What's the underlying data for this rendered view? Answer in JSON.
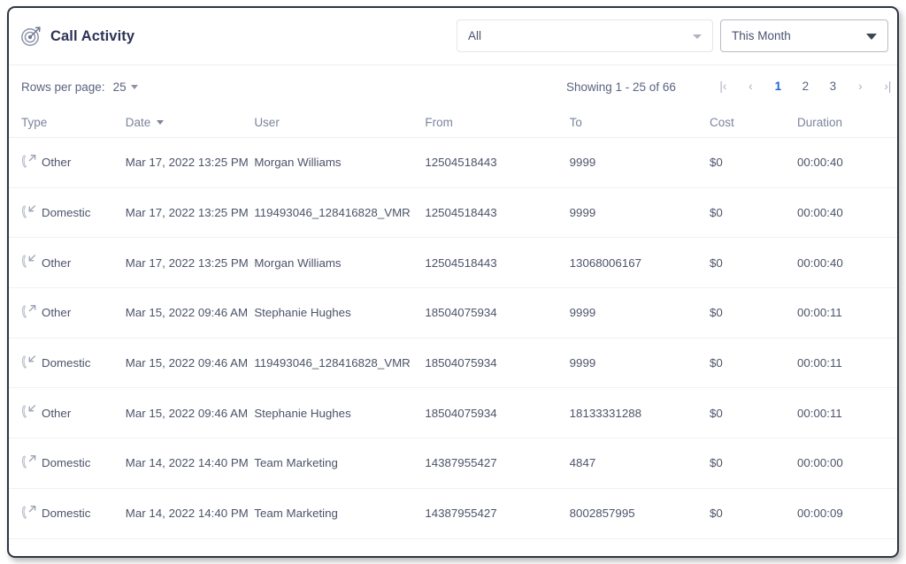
{
  "header": {
    "logo_icon": "target-dart-icon",
    "title": "Call Activity",
    "filter_type": {
      "value": "All",
      "icon": "chevron-down-icon"
    },
    "filter_period": {
      "value": "This Month",
      "icon": "chevron-down-icon"
    }
  },
  "toolbar": {
    "rows_per_page_label": "Rows per page:",
    "rows_per_page_value": "25",
    "showing": "Showing 1 - 25 of 66",
    "pager": {
      "first": "|‹",
      "prev": "‹",
      "pages": [
        "1",
        "2",
        "3"
      ],
      "active_page": "1",
      "next": "›",
      "last": "›|"
    }
  },
  "table": {
    "columns": [
      {
        "key": "type",
        "label": "Type"
      },
      {
        "key": "date",
        "label": "Date",
        "sorted": true,
        "sort_icon": "caret-down-icon"
      },
      {
        "key": "user",
        "label": "User"
      },
      {
        "key": "from",
        "label": "From"
      },
      {
        "key": "to",
        "label": "To"
      },
      {
        "key": "cost",
        "label": "Cost"
      },
      {
        "key": "duration",
        "label": "Duration"
      }
    ],
    "rows": [
      {
        "direction": "outbound",
        "type": "Other",
        "date": "Mar 17, 2022 13:25 PM",
        "user": "Morgan Williams",
        "from": "12504518443",
        "to": "9999",
        "cost": "$0",
        "duration": "00:00:40"
      },
      {
        "direction": "inbound",
        "type": "Domestic",
        "date": "Mar 17, 2022 13:25 PM",
        "user": "119493046_128416828_VMR",
        "from": "12504518443",
        "to": "9999",
        "cost": "$0",
        "duration": "00:00:40"
      },
      {
        "direction": "inbound",
        "type": "Other",
        "date": "Mar 17, 2022 13:25 PM",
        "user": "Morgan Williams",
        "from": "12504518443",
        "to": "13068006167",
        "cost": "$0",
        "duration": "00:00:40"
      },
      {
        "direction": "outbound",
        "type": "Other",
        "date": "Mar 15, 2022 09:46 AM",
        "user": "Stephanie Hughes",
        "from": "18504075934",
        "to": "9999",
        "cost": "$0",
        "duration": "00:00:11"
      },
      {
        "direction": "inbound",
        "type": "Domestic",
        "date": "Mar 15, 2022 09:46 AM",
        "user": "119493046_128416828_VMR",
        "from": "18504075934",
        "to": "9999",
        "cost": "$0",
        "duration": "00:00:11"
      },
      {
        "direction": "inbound",
        "type": "Other",
        "date": "Mar 15, 2022 09:46 AM",
        "user": "Stephanie Hughes",
        "from": "18504075934",
        "to": "18133331288",
        "cost": "$0",
        "duration": "00:00:11"
      },
      {
        "direction": "outbound",
        "type": "Domestic",
        "date": "Mar 14, 2022 14:40 PM",
        "user": "Team Marketing",
        "from": "14387955427",
        "to": "4847",
        "cost": "$0",
        "duration": "00:00:00"
      },
      {
        "direction": "outbound",
        "type": "Domestic",
        "date": "Mar 14, 2022 14:40 PM",
        "user": "Team Marketing",
        "from": "14387955427",
        "to": "8002857995",
        "cost": "$0",
        "duration": "00:00:09"
      }
    ]
  },
  "colors": {
    "accent": "#1b66d6",
    "title": "#2d3355",
    "text": "#4c5469",
    "muted": "#7b849c",
    "border": "#2f3542",
    "divider": "#f0f1f4"
  }
}
